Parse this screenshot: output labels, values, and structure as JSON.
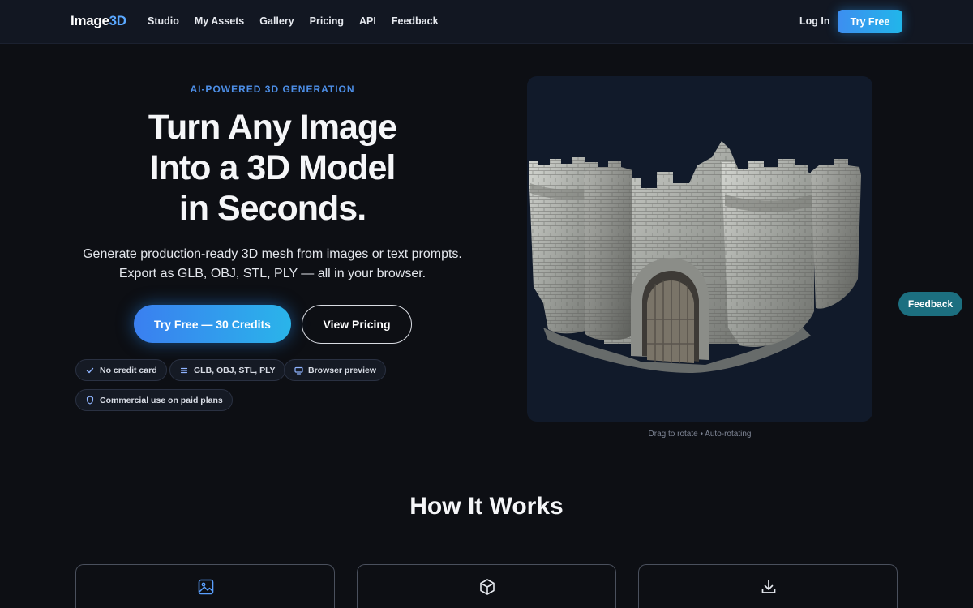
{
  "nav": {
    "logo_main": "Image",
    "logo_accent": "3D",
    "links": [
      "Studio",
      "My Assets",
      "Gallery",
      "Pricing",
      "API",
      "Feedback"
    ],
    "login_label": "Log In",
    "try_free_label": "Try Free"
  },
  "hero": {
    "eyebrow": "AI-POWERED 3D GENERATION",
    "headline_line1": "Turn Any Image",
    "headline_line2": "Into a 3D Model",
    "headline_line3": "in Seconds.",
    "subtext_line1": "Generate production-ready 3D mesh from images or text prompts.",
    "subtext_line2": "Export as GLB, OBJ, STL, PLY — all in your browser.",
    "cta_primary": "Try Free — 30 Credits",
    "cta_secondary": "View Pricing",
    "pills": [
      {
        "label": "No credit card",
        "icon": "check-icon"
      },
      {
        "label": "GLB, OBJ, STL, PLY",
        "icon": "list-icon"
      },
      {
        "label": "Browser preview",
        "icon": "monitor-icon"
      },
      {
        "label": "Commercial use on paid plans",
        "icon": "shield-icon"
      }
    ]
  },
  "viewer": {
    "caption": "Drag to rotate • Auto-rotating",
    "model": "stone castle gate 3D model"
  },
  "feedback_float": "Feedback",
  "how_it_works": {
    "title": "How It Works",
    "steps": [
      {
        "icon": "image-icon"
      },
      {
        "icon": "cube-icon"
      },
      {
        "icon": "download-icon"
      }
    ]
  },
  "colors": {
    "background": "#0d0f14",
    "nav_background": "#121722",
    "accent_blue": "#3d8ef0",
    "accent_cyan": "#21b6ea",
    "eyebrow": "#4d8fe8",
    "feedback_teal": "#1c6f80"
  }
}
